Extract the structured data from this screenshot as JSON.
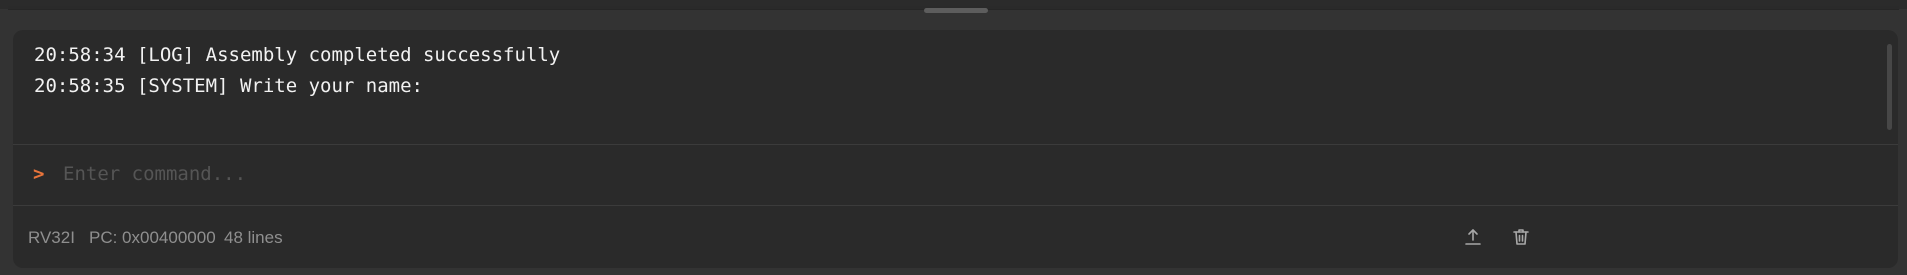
{
  "console": {
    "lines": [
      {
        "time": "20:58:34",
        "tag": "[LOG]",
        "message": "Assembly completed successfully"
      },
      {
        "time": "20:58:35",
        "tag": "[SYSTEM]",
        "message": "Write your name:"
      }
    ],
    "prompt_symbol": ">",
    "input_placeholder": "Enter command...",
    "input_value": ""
  },
  "status": {
    "isa": "RV32I",
    "pc": "PC: 0x00400000",
    "lines": "48 lines"
  },
  "actions": {
    "export_icon": "upload-icon",
    "clear_icon": "trash-icon"
  },
  "colors": {
    "background": "#333333",
    "panel": "#2a2a2a",
    "prompt_accent": "#e8743b",
    "text": "#f2f2f2",
    "muted": "#8f8f8f"
  }
}
